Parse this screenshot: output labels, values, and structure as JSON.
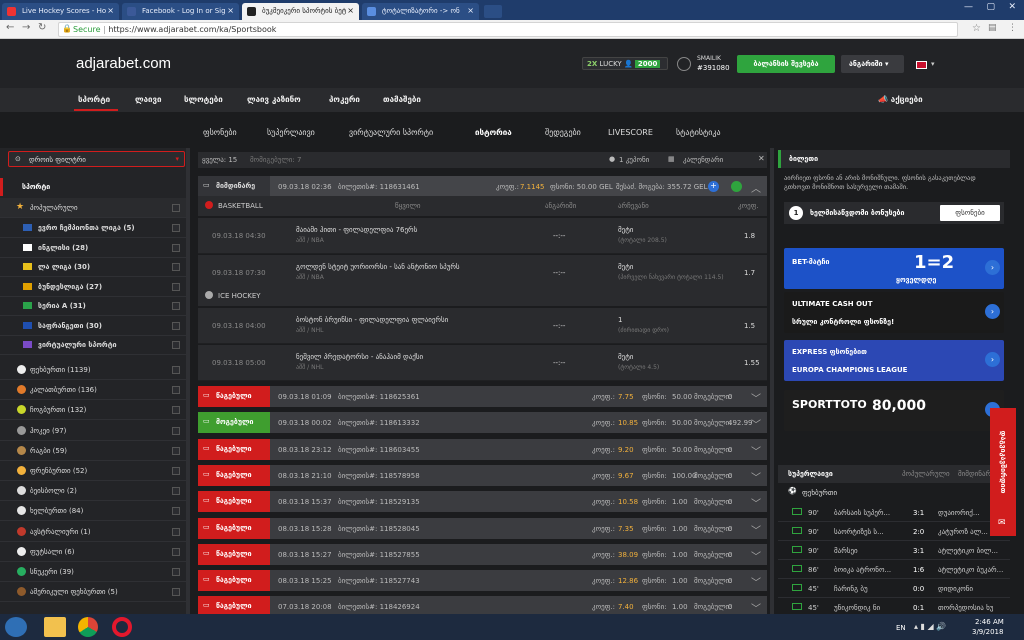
{
  "browser": {
    "tabs": [
      {
        "title": "Live Hockey Scores - Ho",
        "color": "#e33"
      },
      {
        "title": "Facebook - Log In or Sig",
        "color": "#3b5998"
      },
      {
        "title": "ბუკმეიკერი სპორტის ბეტ",
        "color": "#222"
      },
      {
        "title": "ტოტალიზატორი -> ონ",
        "color": "#5a8ee0"
      }
    ],
    "secure_label": "Secure",
    "url": "https://www.adjarabet.com/ka/Sportsbook"
  },
  "header": {
    "logo": "adjarabet.com",
    "promo_2x": "2X",
    "promo_lucky": "LUCKY",
    "promo_value": "2000",
    "username": "SMAILIK",
    "user_id": "#391080",
    "deposit_button": "ბალანსის შევსება",
    "account_button": "ანგარიში"
  },
  "main_nav": [
    "სპორტი",
    "ლაივი",
    "სლოტები",
    "ლაივ კაზინო",
    "პოკერი",
    "თამაშები"
  ],
  "main_nav_right": "აქციები",
  "sub_nav": [
    "ფსონები",
    "სუპერლაივი",
    "ვირტუალური სპორტი",
    "ისტორია",
    "შედეგები",
    "LIVESCORE",
    "სტატისტიკა"
  ],
  "left": {
    "filter_label": "დროის ფილტრი",
    "section_label": "სპორტი",
    "popular_label": "პოპულარული",
    "leagues": [
      {
        "name": "ევრო ჩემპიონთა ლიგა (5)",
        "flag": "#2d5fb4"
      },
      {
        "name": "ინგლისი (28)",
        "flag": "#ffffff"
      },
      {
        "name": "ლა ლიგა (30)",
        "flag": "#e8c01c"
      },
      {
        "name": "ბუნდესლიგა (27)",
        "flag": "#e0a000"
      },
      {
        "name": "სერია A (31)",
        "flag": "#2aa24a"
      },
      {
        "name": "საფრანგეთი (30)",
        "flag": "#1f4fb0"
      },
      {
        "name": "ვირტუალური სპორტი",
        "flag": "#7a4bc7"
      }
    ],
    "sports": [
      {
        "name": "ფეხბურთი (1139)",
        "color": "#eeeeee"
      },
      {
        "name": "კალათბურთი (136)",
        "color": "#e07a2a"
      },
      {
        "name": "ჩოგბურთი (132)",
        "color": "#c8d62a"
      },
      {
        "name": "ჰოკეი (97)",
        "color": "#999999"
      },
      {
        "name": "რაგბი (59)",
        "color": "#b5884a"
      },
      {
        "name": "ფრენბურთი (52)",
        "color": "#f2b13c"
      },
      {
        "name": "ბეისბოლი (2)",
        "color": "#dddddd"
      },
      {
        "name": "ხელბურთი (84)",
        "color": "#e6e6e6"
      },
      {
        "name": "ავსტრალიური (1)",
        "color": "#c0392b"
      },
      {
        "name": "ფუტსალი (6)",
        "color": "#eeeeee"
      },
      {
        "name": "სნუკერი (39)",
        "color": "#27ae60"
      },
      {
        "name": "ამერიკული ფეხბურთი (5)",
        "color": "#8e5a2b"
      }
    ]
  },
  "center": {
    "header_count_label": "ყველა: 15",
    "header_filter": "მომიგებული: 7",
    "header_coupon": "1 კუპონი",
    "header_calendar": "კალენდარი",
    "open_row": {
      "status": "მიმდინარე",
      "date": "09.03.18 02:36",
      "ticket": "ბილეთის#: 118631461",
      "odds_label": "კოეფ.:",
      "odds": "7.1145",
      "stake": "ფსონი: 50.00 GEL",
      "win": "შესაძ. მოგება: 355.72 GEL"
    },
    "groups": [
      {
        "sport": "BASKETBALL",
        "col_event": "წყვილი",
        "col_result": "ანგარიში",
        "col_pick": "არჩევანი",
        "col_odds": "კოეფ.",
        "events": [
          {
            "date": "09.03.18 04:30",
            "teams": "მაიამი ჰითი - ფილადელფია 76ერს",
            "league": "აშშ / NBA",
            "score": "--:--",
            "pick": "მეტი",
            "pick_sub": "(ტოტალი 208.5)",
            "odds": "1.8"
          },
          {
            "date": "09.03.18 07:30",
            "teams": "გოლდენ სტეიტ უორიორსი - სან ანტონიო სპურს",
            "league": "აშშ / NBA",
            "score": "--:--",
            "pick": "მეტი",
            "pick_sub": "(პირველი ნახევარი ტოტალი 114.5)",
            "odds": "1.7"
          }
        ]
      },
      {
        "sport": "ICE HOCKEY",
        "events": [
          {
            "date": "09.03.18 04:00",
            "teams": "ბოსტონ ბრუინსი - ფილადელფია ფლაიერსი",
            "league": "აშშ / NHL",
            "score": "--:--",
            "pick": "1",
            "pick_sub": "(ძირითადი დრო)",
            "odds": "1.5"
          },
          {
            "date": "09.03.18 05:00",
            "teams": "ნეშვილ პრედატორსი - ანაჰაიმ დაქსი",
            "league": "აშშ / NHL",
            "score": "--:--",
            "pick": "მეტი",
            "pick_sub": "(ტოტალი 4.5)",
            "odds": "1.55"
          }
        ]
      }
    ],
    "history": [
      {
        "status": "წაგებული",
        "st_color": "#d11d1d",
        "date": "09.03.18 01:09",
        "ticket": "ბილეთის#: 118625361",
        "odds": "7.75",
        "stake": "50.00",
        "win": "0"
      },
      {
        "status": "მოგებული",
        "st_color": "#3f9e2f",
        "date": "09.03.18 00:02",
        "ticket": "ბილეთის#: 118613332",
        "odds": "10.85",
        "stake": "50.00",
        "win": "492.99"
      },
      {
        "status": "წაგებული",
        "st_color": "#d11d1d",
        "date": "08.03.18 23:12",
        "ticket": "ბილეთის#: 118603455",
        "odds": "9.20",
        "stake": "50.00",
        "win": "0"
      },
      {
        "status": "წაგებული",
        "st_color": "#d11d1d",
        "date": "08.03.18 21:10",
        "ticket": "ბილეთის#: 118578958",
        "odds": "9.67",
        "stake": "100.00",
        "win": "0"
      },
      {
        "status": "წაგებული",
        "st_color": "#d11d1d",
        "date": "08.03.18 15:37",
        "ticket": "ბილეთის#: 118529135",
        "odds": "10.58",
        "stake": "1.00",
        "win": "0"
      },
      {
        "status": "წაგებული",
        "st_color": "#d11d1d",
        "date": "08.03.18 15:28",
        "ticket": "ბილეთის#: 118528045",
        "odds": "7.35",
        "stake": "1.00",
        "win": "0"
      },
      {
        "status": "წაგებული",
        "st_color": "#d11d1d",
        "date": "08.03.18 15:27",
        "ticket": "ბილეთის#: 118527855",
        "odds": "38.09",
        "stake": "1.00",
        "win": "0"
      },
      {
        "status": "წაგებული",
        "st_color": "#d11d1d",
        "date": "08.03.18 15:25",
        "ticket": "ბილეთის#: 118527743",
        "odds": "12.86",
        "stake": "1.00",
        "win": "0"
      },
      {
        "status": "წაგებული",
        "st_color": "#d11d1d",
        "date": "07.03.18 20:08",
        "ticket": "ბილეთის#: 118426924",
        "odds": "7.40",
        "stake": "1.00",
        "win": "0"
      }
    ],
    "odds_label": "კოეფ.:",
    "stake_label": "ფსონი:",
    "win_label": "მოგებული:"
  },
  "right": {
    "ticket_title": "ბილეთი",
    "ticket_text": "აირჩიეთ ფსონი ან არის მონიშნული. ფსონის გასაკეთებლად გთხოვთ მონიშნოთ სასურველი თამაში.",
    "bonus_num": "1",
    "bonus_text": "ხელმისაწვდომი ბონუსები",
    "bonus_btn": "ფსონები",
    "banners": [
      {
        "title": "BET-მატჩი",
        "sub": "1=2",
        "sub2": "ყოველდღე",
        "bg": "#1d52c8"
      },
      {
        "title": "ULTIMATE CASH OUT",
        "sub": "სრული კონტროლი ფსონზე!",
        "bg": "#1a1a1a"
      },
      {
        "title": "EXPRESS ფსონებით",
        "sub": "EUROPA CHAMPIONS LEAGUE",
        "bg": "#2c48b4"
      },
      {
        "title": "SPORTTOTO",
        "sub": "80,000",
        "bg": "#1e1e1e"
      }
    ],
    "live_tabs": [
      "სუპერლაივი",
      "პოპულარული",
      "მიმდინარე"
    ],
    "live_sport": "ფეხბურთი",
    "live_rows": [
      {
        "min": "90'",
        "home": "ბარსაის სუპერ...",
        "score": "3:1",
        "away": "დუაიორიქ..."
      },
      {
        "min": "90'",
        "home": "საორტიზეს ს...",
        "score": "2:0",
        "away": "კატუროზ ალ..."
      },
      {
        "min": "90'",
        "home": "მარსეი",
        "score": "3:1",
        "away": "ატლეტიკო ბილ..."
      },
      {
        "min": "86'",
        "home": "ბოიკა ატრონო...",
        "score": "1:6",
        "away": "ატლეტიკო ბუკარ..."
      },
      {
        "min": "45'",
        "home": "ჩარინგ ბუ",
        "score": "0:0",
        "away": "დიდიკონი"
      },
      {
        "min": "45'",
        "home": "უნიკონდიკ ნი",
        "score": "0:1",
        "away": "თორპედოსია ხუ"
      }
    ],
    "side_tab": "დაგვიკავშირდით"
  },
  "taskbar": {
    "lang": "EN",
    "time": "2:46 AM",
    "date": "3/9/2018"
  }
}
